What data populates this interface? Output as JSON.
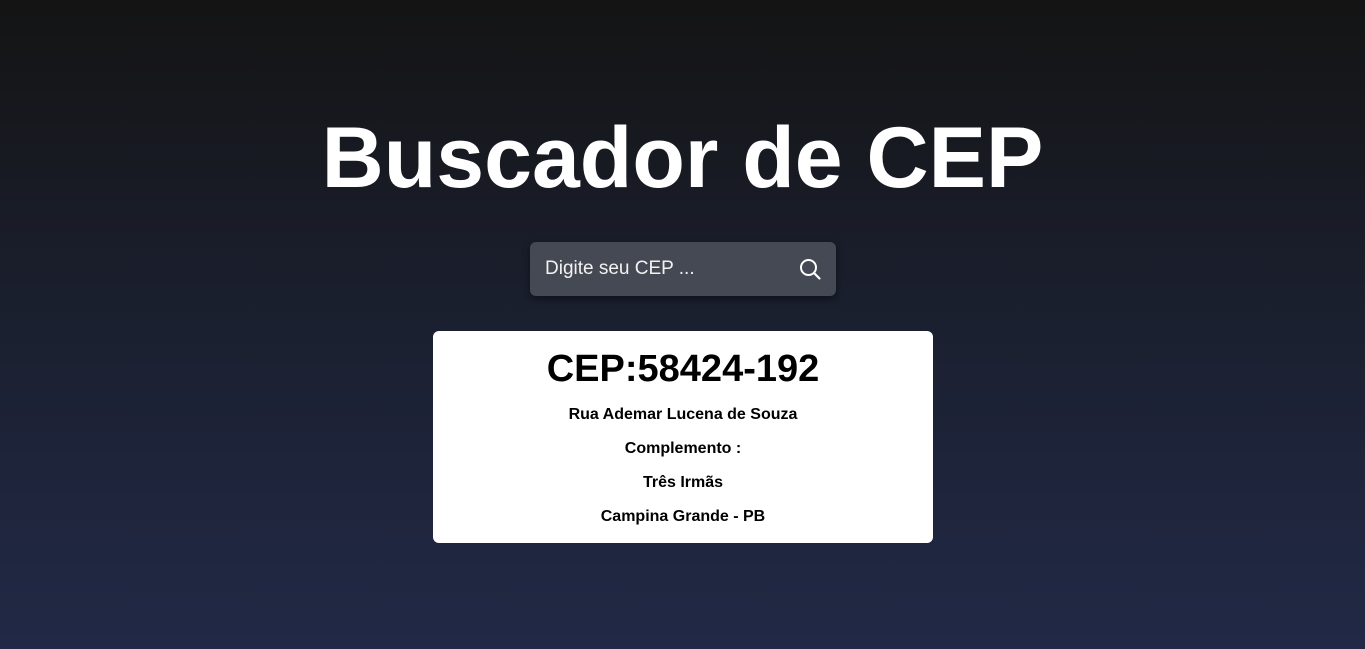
{
  "header": {
    "title": "Buscador de CEP"
  },
  "search": {
    "placeholder": "Digite seu CEP ...",
    "value": "",
    "button_icon": "search-icon"
  },
  "result": {
    "cep_label": "CEP:",
    "cep_value": "58424-192",
    "street": "Rua Ademar Lucena de Souza",
    "complement_label": "Complemento :",
    "complement_value": "",
    "neighborhood": "Três Irmãs",
    "city_state": "Campina Grande - PB"
  },
  "colors": {
    "background_top": "#141414",
    "background_bottom": "#212946",
    "search_bg": "#454953",
    "card_bg": "#ffffff",
    "text_light": "#ffffff",
    "text_dark": "#000000"
  }
}
